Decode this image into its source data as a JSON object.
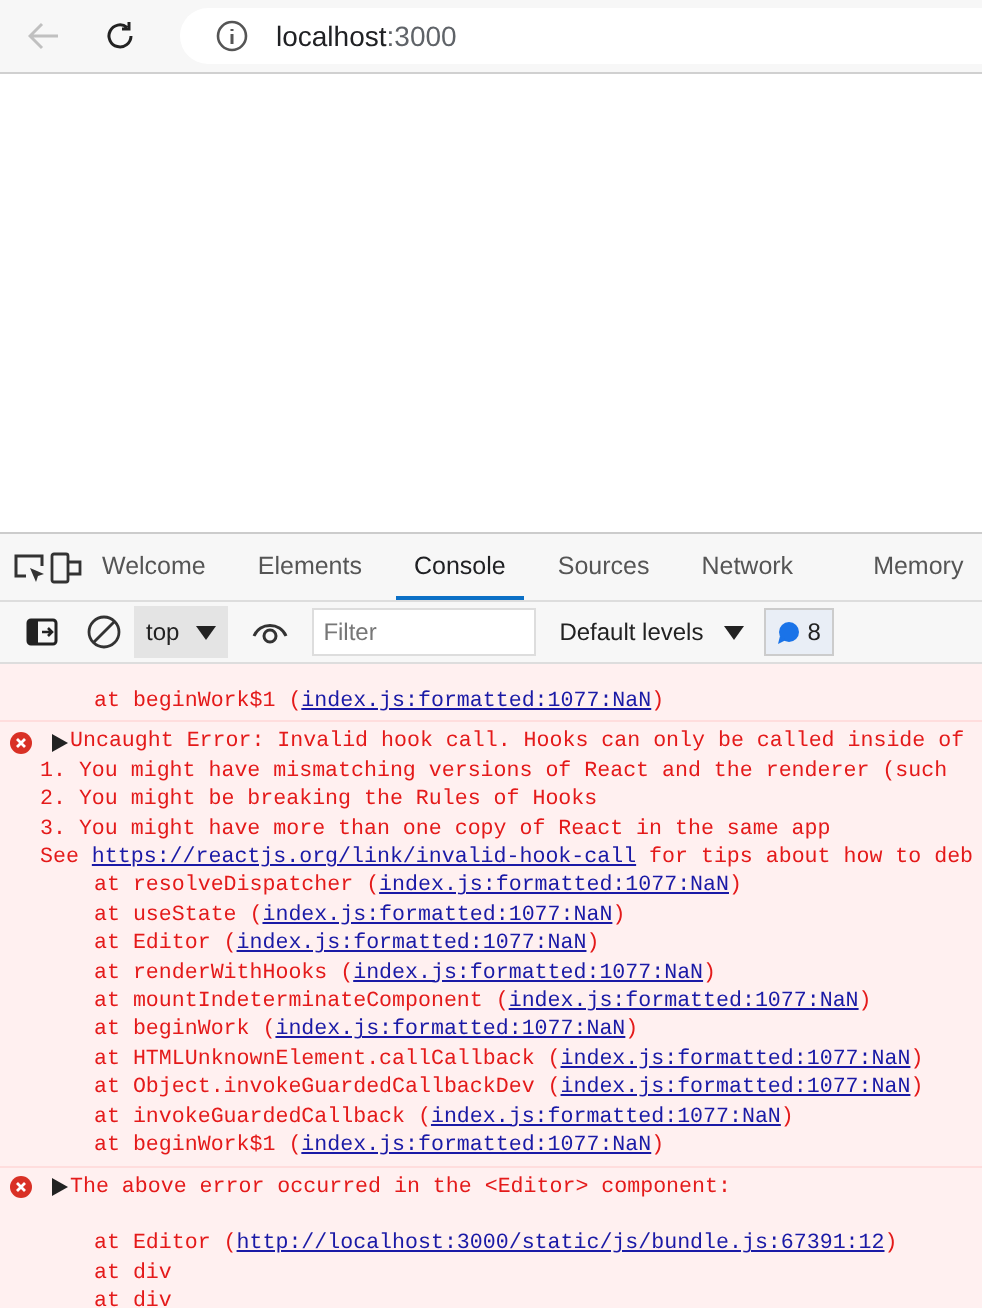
{
  "browser": {
    "url_host": "localhost",
    "url_port": ":3000"
  },
  "devtools": {
    "tabs": [
      {
        "label": "Welcome",
        "selected": false
      },
      {
        "label": "Elements",
        "selected": false
      },
      {
        "label": "Console",
        "selected": true
      },
      {
        "label": "Sources",
        "selected": false
      },
      {
        "label": "Network",
        "selected": false
      },
      {
        "label": "Memory",
        "selected": false
      }
    ],
    "toolbar": {
      "context": "top",
      "filter_placeholder": "Filter",
      "levels": "Default levels",
      "issues_count": "8"
    }
  },
  "console": [
    {
      "kind": "continuation",
      "lines": [
        {
          "kind": "stack",
          "parts": [
            {
              "text": "at beginWork$1 ("
            },
            {
              "link": "index.js:formatted:1077:NaN"
            },
            {
              "text": ")"
            }
          ]
        }
      ]
    },
    {
      "kind": "error",
      "expanded": false,
      "header": "Uncaught Error: Invalid hook call. Hooks can only be called inside of",
      "lines": [
        {
          "kind": "message",
          "parts": [
            {
              "text": "1. You might have mismatching versions of React and the renderer (such"
            }
          ]
        },
        {
          "kind": "message",
          "parts": [
            {
              "text": "2. You might be breaking the Rules of Hooks"
            }
          ]
        },
        {
          "kind": "message",
          "parts": [
            {
              "text": "3. You might have more than one copy of React in the same app"
            }
          ]
        },
        {
          "kind": "message",
          "parts": [
            {
              "text": "See "
            },
            {
              "link": "https://reactjs.org/link/invalid-hook-call"
            },
            {
              "text": " for tips about how to deb"
            }
          ]
        },
        {
          "kind": "stack",
          "parts": [
            {
              "text": "at resolveDispatcher ("
            },
            {
              "link": "index.js:formatted:1077:NaN"
            },
            {
              "text": ")"
            }
          ]
        },
        {
          "kind": "stack",
          "parts": [
            {
              "text": "at useState ("
            },
            {
              "link": "index.js:formatted:1077:NaN"
            },
            {
              "text": ")"
            }
          ]
        },
        {
          "kind": "stack",
          "parts": [
            {
              "text": "at Editor ("
            },
            {
              "link": "index.js:formatted:1077:NaN"
            },
            {
              "text": ")"
            }
          ]
        },
        {
          "kind": "stack",
          "parts": [
            {
              "text": "at renderWithHooks ("
            },
            {
              "link": "index.js:formatted:1077:NaN"
            },
            {
              "text": ")"
            }
          ]
        },
        {
          "kind": "stack",
          "parts": [
            {
              "text": "at mountIndeterminateComponent ("
            },
            {
              "link": "index.js:formatted:1077:NaN"
            },
            {
              "text": ")"
            }
          ]
        },
        {
          "kind": "stack",
          "parts": [
            {
              "text": "at beginWork ("
            },
            {
              "link": "index.js:formatted:1077:NaN"
            },
            {
              "text": ")"
            }
          ]
        },
        {
          "kind": "stack",
          "parts": [
            {
              "text": "at HTMLUnknownElement.callCallback ("
            },
            {
              "link": "index.js:formatted:1077:NaN"
            },
            {
              "text": ")"
            }
          ]
        },
        {
          "kind": "stack",
          "parts": [
            {
              "text": "at Object.invokeGuardedCallbackDev ("
            },
            {
              "link": "index.js:formatted:1077:NaN"
            },
            {
              "text": ")"
            }
          ]
        },
        {
          "kind": "stack",
          "parts": [
            {
              "text": "at invokeGuardedCallback ("
            },
            {
              "link": "index.js:formatted:1077:NaN"
            },
            {
              "text": ")"
            }
          ]
        },
        {
          "kind": "stack",
          "parts": [
            {
              "text": "at beginWork$1 ("
            },
            {
              "link": "index.js:formatted:1077:NaN"
            },
            {
              "text": ")"
            }
          ]
        }
      ]
    },
    {
      "kind": "error",
      "expanded": false,
      "header": "The above error occurred in the <Editor> component:",
      "lines": [
        {
          "kind": "blank"
        },
        {
          "kind": "stack",
          "parts": [
            {
              "text": "at Editor ("
            },
            {
              "link": "http://localhost:3000/static/js/bundle.js:67391:12"
            },
            {
              "text": ")"
            }
          ]
        },
        {
          "kind": "stack",
          "parts": [
            {
              "text": "at div"
            }
          ]
        },
        {
          "kind": "stack",
          "parts": [
            {
              "text": "at div"
            }
          ]
        }
      ]
    }
  ]
}
